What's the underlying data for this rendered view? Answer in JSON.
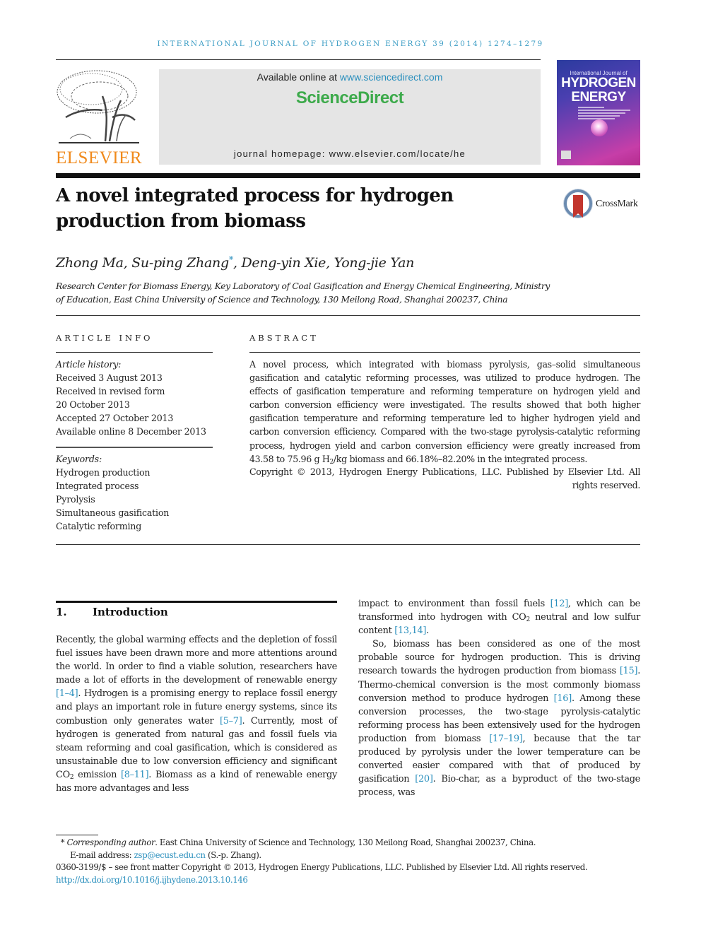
{
  "running_head": "INTERNATIONAL JOURNAL OF HYDROGEN ENERGY 39 (2014) 1274–1279",
  "header": {
    "publisher_wordmark": "ELSEVIER",
    "available_online_prefix": "Available online at ",
    "available_online_link": "www.sciencedirect.com",
    "sciencedirect_brand": "ScienceDirect",
    "journal_homepage": "journal homepage: www.elsevier.com/locate/he",
    "cover": {
      "line1": "International Journal of",
      "line2": "HYDROGEN",
      "line3": "ENERGY"
    },
    "colors": {
      "elsevier_orange": "#f08a1c",
      "sciencedirect_green": "#3daa4b",
      "link_blue": "#2a8fbd"
    }
  },
  "article": {
    "title": "A novel integrated process for hydrogen production from biomass",
    "crossmark_label": "CrossMark",
    "authors": [
      {
        "name": "Zhong Ma",
        "corresponding": false
      },
      {
        "name": "Su-ping Zhang",
        "corresponding": true
      },
      {
        "name": "Deng-yin Xie",
        "corresponding": false
      },
      {
        "name": "Yong-jie Yan",
        "corresponding": false
      }
    ],
    "affiliation": "Research Center for Biomass Energy, Key Laboratory of Coal Gasification and Energy Chemical Engineering, Ministry of Education, East China University of Science and Technology, 130 Meilong Road, Shanghai 200237, China"
  },
  "article_info": {
    "heading": "ARTICLE INFO",
    "history_label": "Article history:",
    "history": [
      "Received 3 August 2013",
      "Received in revised form",
      "20 October 2013",
      "Accepted 27 October 2013",
      "Available online 8 December 2013"
    ],
    "keywords_label": "Keywords:",
    "keywords": [
      "Hydrogen production",
      "Integrated process",
      "Pyrolysis",
      "Simultaneous gasification",
      "Catalytic reforming"
    ]
  },
  "abstract": {
    "heading": "ABSTRACT",
    "body_part1": "A novel process, which integrated with biomass pyrolysis, gas–solid simultaneous gasification and catalytic reforming processes, was utilized to produce hydrogen. The effects of gasification temperature and reforming temperature on hydrogen yield and carbon conversion efficiency were investigated. The results showed that both higher gasification temperature and reforming temperature led to higher hydrogen yield and carbon conversion efficiency. Compared with the two-stage pyrolysis-catalytic reforming process, hydrogen yield and carbon conversion efficiency were greatly increased from 43.58 to 75.96 g H",
    "body_sub": "2",
    "body_part2": "/kg biomass and 66.18%–82.20% in the integrated process.",
    "copyright": "Copyright © 2013, Hydrogen Energy Publications, LLC. Published by Elsevier Ltd. All rights reserved."
  },
  "introduction": {
    "number": "1.",
    "title": "Introduction",
    "left": [
      {
        "t": "Recently, the global warming effects and the depletion of fossil fuel issues have been drawn more and more attentions around the world. In order to find a viable solution, researchers have made a lot of efforts in the development of renewable energy "
      },
      {
        "ref": "[1–4]"
      },
      {
        "t": ". Hydrogen is a promising energy to replace fossil energy and plays an important role in future energy systems, since its combustion only generates water "
      },
      {
        "ref": "[5–7]"
      },
      {
        "t": ". Currently, most of hydrogen is generated from natural gas and fossil fuels via steam reforming and coal gasification, which is considered as unsustainable due to low conversion efficiency and significant CO"
      },
      {
        "sub": "2"
      },
      {
        "t": " emission "
      },
      {
        "ref": "[8–11]"
      },
      {
        "t": ". Biomass as a kind of renewable energy has more advantages and less"
      }
    ],
    "right_p1": [
      {
        "t": "impact to environment than fossil fuels "
      },
      {
        "ref": "[12]"
      },
      {
        "t": ", which can be transformed into hydrogen with CO"
      },
      {
        "sub": "2"
      },
      {
        "t": " neutral and low sulfur content "
      },
      {
        "ref": "[13,14]"
      },
      {
        "t": "."
      }
    ],
    "right_p2": [
      {
        "t": "So, biomass has been considered as one of the most probable source for hydrogen production. This is driving research towards the hydrogen production from biomass "
      },
      {
        "ref": "[15]"
      },
      {
        "t": ". Thermo-chemical conversion is the most commonly biomass conversion method to produce hydrogen "
      },
      {
        "ref": "[16]"
      },
      {
        "t": ". Among these conversion processes, the two-stage pyrolysis-catalytic reforming process has been extensively used for the hydrogen production from biomass "
      },
      {
        "ref": "[17–19]"
      },
      {
        "t": ", because that the tar produced by pyrolysis under the lower temperature can be converted easier compared with that of produced by gasification "
      },
      {
        "ref": "[20]"
      },
      {
        "t": ". Bio-char, as a byproduct of the two-stage process, was"
      }
    ]
  },
  "footnotes": {
    "star": "*",
    "corresponding_label": "Corresponding author",
    "corresponding_text": ". East China University of Science and Technology, 130 Meilong Road, Shanghai 200237, China.",
    "email_label": "E-mail address: ",
    "email": "zsp@ecust.edu.cn",
    "email_suffix": " (S.-p. Zhang).",
    "front_matter": "0360-3199/$ – see front matter Copyright © 2013, Hydrogen Energy Publications, LLC. Published by Elsevier Ltd. All rights reserved.",
    "doi": "http://dx.doi.org/10.1016/j.ijhydene.2013.10.146"
  }
}
